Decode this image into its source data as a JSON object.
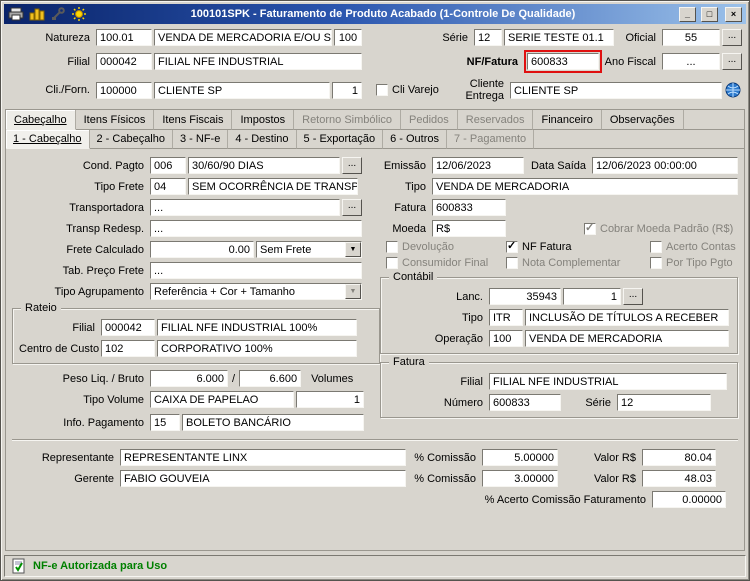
{
  "window": {
    "title": "100101SPK - Faturamento de Produto Acabado (1-Controle De Qualidade)",
    "controls": {
      "minimize": "_",
      "maximize": "□",
      "close": "×"
    }
  },
  "icons": {
    "dropdown_arrow": "▼",
    "check": "✓"
  },
  "ui": {
    "ellipsis": "..."
  },
  "header": {
    "natureza": {
      "label": "Natureza",
      "code": "100.01",
      "desc": "VENDA DE MERCADORIA E/OU SERVI",
      "extra": "100"
    },
    "serie": {
      "label": "Série",
      "code": "12",
      "desc": "SERIE TESTE 01.1"
    },
    "oficial": {
      "label": "Oficial",
      "value": "55"
    },
    "filial": {
      "label": "Filial",
      "code": "000042",
      "desc": "FILIAL NFE INDUSTRIAL"
    },
    "nf_fatura": {
      "label": "NF/Fatura",
      "value": "600833"
    },
    "ano_fiscal": {
      "label": "Ano Fiscal",
      "value": "..."
    },
    "cli_forn": {
      "label": "Cli./Forn.",
      "code": "100000",
      "desc": "CLIENTE SP",
      "seq": "1"
    },
    "cli_varejo": {
      "label": "Cli Varejo",
      "checked": false
    },
    "cliente_entrega": {
      "label": "Cliente Entrega",
      "value": "CLIENTE SP"
    }
  },
  "tabs": {
    "main": [
      {
        "label": "Cabeçalho",
        "state": "active"
      },
      {
        "label": "Itens Físicos",
        "state": "enabled"
      },
      {
        "label": "Itens Fiscais",
        "state": "enabled"
      },
      {
        "label": "Impostos",
        "state": "enabled"
      },
      {
        "label": "Retorno Simbólico",
        "state": "disabled"
      },
      {
        "label": "Pedidos",
        "state": "disabled"
      },
      {
        "label": "Reservados",
        "state": "disabled"
      },
      {
        "label": "Financeiro",
        "state": "enabled"
      },
      {
        "label": "Observações",
        "state": "enabled"
      }
    ],
    "sub": [
      {
        "label": "1 - Cabeçalho",
        "state": "active"
      },
      {
        "label": "2 - Cabeçalho",
        "state": "enabled"
      },
      {
        "label": "3 - NF-e",
        "state": "enabled"
      },
      {
        "label": "4 - Destino",
        "state": "enabled"
      },
      {
        "label": "5 - Exportação",
        "state": "enabled"
      },
      {
        "label": "6 - Outros",
        "state": "enabled"
      },
      {
        "label": "7 - Pagamento",
        "state": "disabled"
      }
    ]
  },
  "left": {
    "cond_pagto": {
      "label": "Cond. Pagto",
      "code": "006",
      "desc": "30/60/90 DIAS"
    },
    "tipo_frete": {
      "label": "Tipo Frete",
      "code": "04",
      "desc": "SEM OCORRÊNCIA DE TRANSPORTE"
    },
    "transportadora": {
      "label": "Transportadora",
      "value": "..."
    },
    "transp_redesp": {
      "label": "Transp Redesp.",
      "value": "..."
    },
    "frete_calculado": {
      "label": "Frete Calculado",
      "value": "0.00",
      "tipo": "Sem Frete"
    },
    "tab_preco_frete": {
      "label": "Tab. Preço Frete",
      "value": "..."
    },
    "tipo_agrupamento": {
      "label": "Tipo Agrupamento",
      "value": "Referência + Cor + Tamanho"
    },
    "rateio": {
      "title": "Rateio",
      "filial": {
        "label": "Filial",
        "code": "000042",
        "desc": "FILIAL NFE INDUSTRIAL 100%"
      },
      "centro_custo": {
        "label": "Centro de Custo",
        "code": "102",
        "desc": "CORPORATIVO 100%"
      }
    },
    "peso": {
      "label": "Peso Liq. / Bruto",
      "liq": "6.000",
      "sep": "/",
      "bruto": "6.600",
      "volumes_label": "Volumes"
    },
    "tipo_volume": {
      "label": "Tipo Volume",
      "value": "CAIXA DE PAPELAO",
      "qty": "1"
    },
    "info_pagamento": {
      "label": "Info. Pagamento",
      "code": "15",
      "desc": "BOLETO BANCÁRIO"
    }
  },
  "right": {
    "emissao": {
      "label": "Emissão",
      "value": "12/06/2023"
    },
    "data_saida": {
      "label": "Data Saída",
      "value": "12/06/2023 00:00:00"
    },
    "tipo": {
      "label": "Tipo",
      "value": "VENDA DE MERCADORIA"
    },
    "fatura": {
      "label": "Fatura",
      "value": "600833"
    },
    "moeda": {
      "label": "Moeda",
      "value": "R$"
    },
    "checkboxes": {
      "cobrar_moeda": {
        "label": "Cobrar Moeda Padrão (R$)",
        "checked": true,
        "disabled": true
      },
      "devolucao": {
        "label": "Devolução",
        "checked": false,
        "disabled": true
      },
      "nf_fatura": {
        "label": "NF Fatura",
        "checked": true,
        "disabled": false
      },
      "acerto_contas": {
        "label": "Acerto Contas",
        "checked": false,
        "disabled": true
      },
      "consumidor_final": {
        "label": "Consumidor Final",
        "checked": false,
        "disabled": true
      },
      "nota_complementar": {
        "label": "Nota Complementar",
        "checked": false,
        "disabled": true
      },
      "por_tipo_pgto": {
        "label": "Por Tipo Pgto",
        "checked": false,
        "disabled": true
      }
    },
    "contabil": {
      "title": "Contábil",
      "lanc": {
        "label": "Lanc.",
        "value": "35943",
        "seq": "1"
      },
      "tipo": {
        "label": "Tipo",
        "code": "ITR",
        "desc": "INCLUSÃO DE TÍTULOS A RECEBER"
      },
      "operacao": {
        "label": "Operação",
        "code": "100",
        "desc": "VENDA DE MERCADORIA"
      }
    },
    "fatura_group": {
      "title": "Fatura",
      "filial": {
        "label": "Filial",
        "value": "FILIAL NFE INDUSTRIAL"
      },
      "numero": {
        "label": "Número",
        "value": "600833"
      },
      "serie": {
        "label": "Série",
        "value": "12"
      }
    }
  },
  "bottom": {
    "representante": {
      "label": "Representante",
      "value": "REPRESENTANTE LINX",
      "comissao_label": "% Comissão",
      "comissao": "5.00000",
      "valor_label": "Valor R$",
      "valor": "80.04"
    },
    "gerente": {
      "label": "Gerente",
      "value": "FABIO GOUVEIA",
      "comissao_label": "% Comissão",
      "comissao": "3.00000",
      "valor_label": "Valor R$",
      "valor": "48.03"
    },
    "acerto_comissao": {
      "label": "% Acerto Comissão Faturamento",
      "value": "0.00000"
    }
  },
  "statusbar": {
    "text": "NF-e Autorizada para Uso",
    "text_color": "#008000"
  },
  "colors": {
    "titlebar_start": "#0a246a",
    "titlebar_end": "#9cc2ea",
    "highlight_red": "#e01010",
    "window_bg": "#d8d5ce"
  }
}
